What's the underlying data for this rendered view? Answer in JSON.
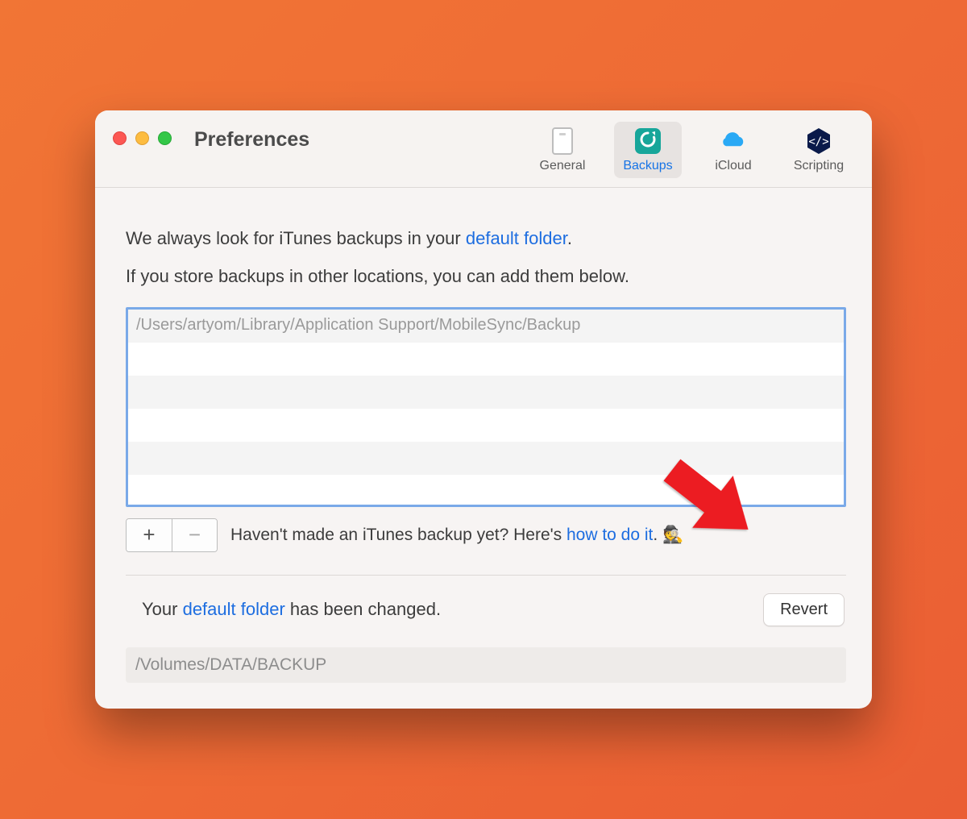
{
  "window": {
    "title": "Preferences"
  },
  "toolbar": {
    "items": [
      {
        "label": "General"
      },
      {
        "label": "Backups"
      },
      {
        "label": "iCloud"
      },
      {
        "label": "Scripting"
      }
    ]
  },
  "intro": {
    "line1_pre": "We always look for iTunes backups in your ",
    "line1_link": "default folder",
    "line1_post": ".",
    "line2": "If you store backups in other locations, you can add them below."
  },
  "list": {
    "rows": [
      "/Users/artyom/Library/Application Support/MobileSync/Backup",
      "",
      "",
      "",
      "",
      ""
    ]
  },
  "buttons": {
    "plus": "+",
    "minus": "−",
    "revert": "Revert"
  },
  "hint": {
    "pre": "Haven't made an iTunes backup yet? Here's ",
    "link": "how to do it",
    "post": ". 🕵️"
  },
  "status": {
    "pre": "Your ",
    "link": "default folder",
    "post": " has been changed."
  },
  "pathbox": {
    "value": "/Volumes/DATA/BACKUP"
  }
}
